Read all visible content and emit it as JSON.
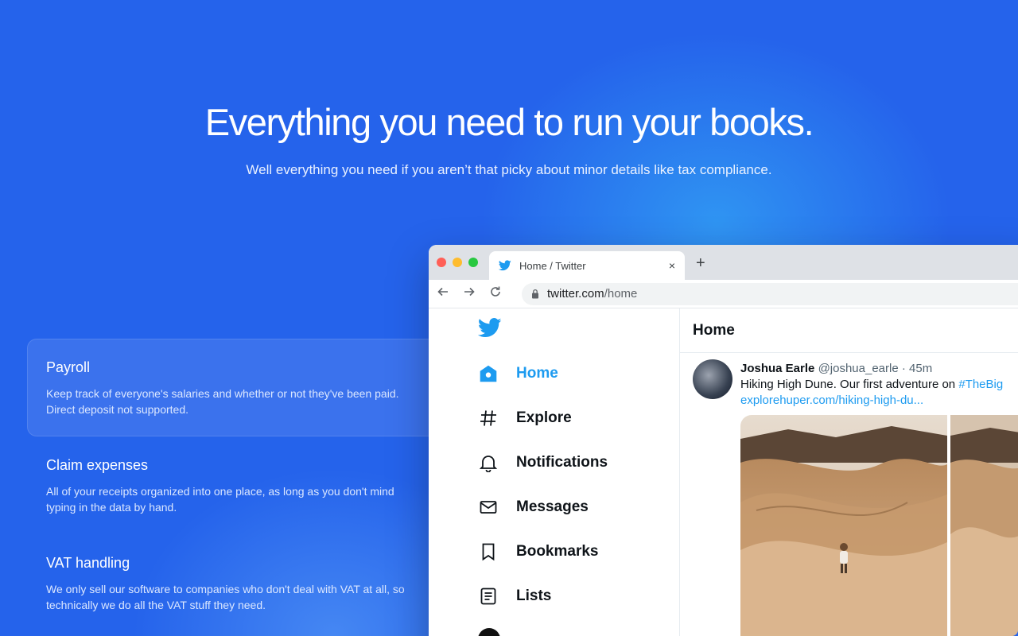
{
  "hero": {
    "title": "Everything you need to run your books.",
    "subtitle": "Well everything you need if you aren’t that picky about minor details like tax compliance."
  },
  "features": [
    {
      "title": "Payroll",
      "description": "Keep track of everyone's salaries and whether or not they've been paid. Direct deposit not supported.",
      "active": true
    },
    {
      "title": "Claim expenses",
      "description": "All of your receipts organized into one place, as long as you don't mind typing in the data by hand.",
      "active": false
    },
    {
      "title": "VAT handling",
      "description": "We only sell our software to companies who don't deal with VAT at all, so technically we do all the VAT stuff they need.",
      "active": false
    }
  ],
  "browser": {
    "tab_title": "Home / Twitter",
    "tab_close": "×",
    "new_tab": "+",
    "url_domain": "twitter.com",
    "url_path": "/home"
  },
  "twitter": {
    "nav": [
      {
        "label": "Home",
        "icon": "home-icon"
      },
      {
        "label": "Explore",
        "icon": "hashtag-icon"
      },
      {
        "label": "Notifications",
        "icon": "bell-icon"
      },
      {
        "label": "Messages",
        "icon": "envelope-icon"
      },
      {
        "label": "Bookmarks",
        "icon": "bookmark-icon"
      },
      {
        "label": "Lists",
        "icon": "list-icon"
      }
    ],
    "header": "Home",
    "tweet": {
      "name": "Joshua Earle",
      "handle": "@joshua_earle",
      "separator": " · ",
      "time": "45m",
      "text": "Hiking High Dune. Our first adventure on ",
      "hashtag": "#TheBig",
      "link": "explorehuper.com/hiking-high-du..."
    }
  },
  "colors": {
    "background": "#2563eb",
    "twitter_blue": "#1d9bf0"
  }
}
